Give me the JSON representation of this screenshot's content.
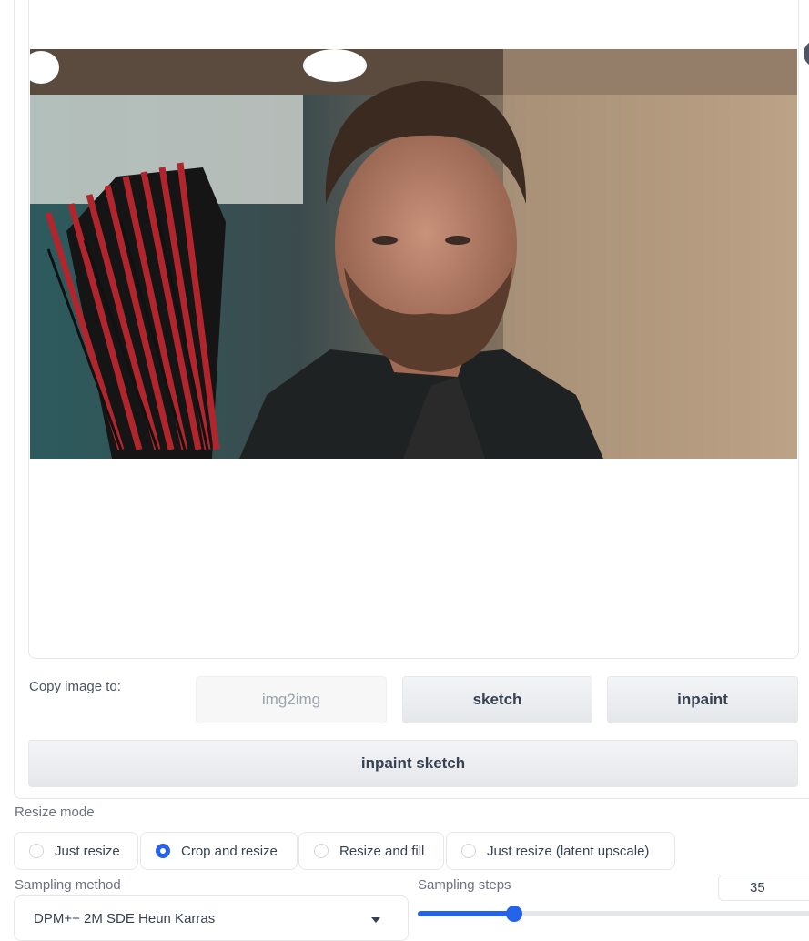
{
  "copy_to": {
    "label": "Copy image to:",
    "buttons": [
      "img2img",
      "sketch",
      "inpaint",
      "inpaint sketch"
    ]
  },
  "resize_mode": {
    "label": "Resize mode",
    "options": [
      "Just resize",
      "Crop and resize",
      "Resize and fill",
      "Just resize (latent upscale)"
    ],
    "selected": "Crop and resize"
  },
  "sampling_method": {
    "label": "Sampling method",
    "value": "DPM++ 2M SDE Heun Karras"
  },
  "sampling_steps": {
    "label": "Sampling steps",
    "value": "35",
    "fraction": 0.24
  },
  "colors": {
    "accent": "#2563eb"
  },
  "image": {
    "subject": "man-with-quiver-of-arrows"
  }
}
